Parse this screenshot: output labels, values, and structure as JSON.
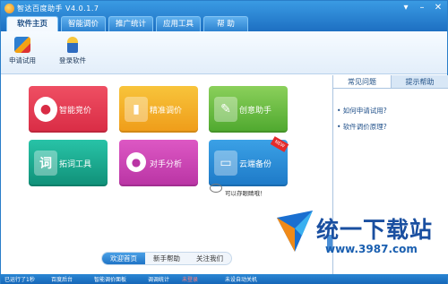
{
  "app": {
    "title": "智达百度助手 V4.0.1.7"
  },
  "window_buttons": [
    "▾",
    "–",
    "✕"
  ],
  "tabs": [
    {
      "label": "软件主页",
      "active": true
    },
    {
      "label": "智能调价",
      "active": false
    },
    {
      "label": "推广统计",
      "active": false
    },
    {
      "label": "应用工具",
      "active": false
    },
    {
      "label": "帮 助",
      "active": false
    }
  ],
  "toolbar": {
    "items": [
      {
        "label": "申请试用",
        "icon": "apply-icon"
      },
      {
        "label": "登录软件",
        "icon": "login-icon"
      }
    ]
  },
  "tiles": [
    {
      "label": "智能竞价",
      "icon_char": "",
      "color": "#e03a52"
    },
    {
      "label": "精准调价",
      "icon_char": "",
      "color": "#f3b12c"
    },
    {
      "label": "创意助手",
      "icon_char": "",
      "color": "#63bb40"
    },
    {
      "label": "拓词工具",
      "icon_char": "词",
      "color": "#19a98f"
    },
    {
      "label": "对手分析",
      "icon_char": "",
      "color": "#c844b2"
    },
    {
      "label": "云端备份",
      "icon_char": "",
      "color": "#2a8bd7"
    }
  ],
  "badge": {
    "label": "NEW"
  },
  "note": {
    "text": "可以存眼睛哦！"
  },
  "pager": {
    "items": [
      "欢迎首页",
      "新手帮助",
      "关注我们"
    ]
  },
  "side": {
    "tabs": [
      "常见问题",
      "提示帮助"
    ],
    "faq": [
      "• 如何申请试用?",
      "• 软件调价原理?"
    ]
  },
  "watermark": {
    "title": "统一下载站",
    "url": "www.3987.com"
  },
  "status": {
    "items": [
      {
        "text": "已运行了1秒",
        "color": "#ffffff"
      },
      {
        "text": "百度后台",
        "color": "#ffffff"
      },
      {
        "text": "智能调价面板",
        "color": "#ffffff"
      },
      {
        "text": "调调统计",
        "color": "#ffffff"
      },
      {
        "text": "未登录",
        "color": "#ff8080"
      },
      {
        "text": "未设自动关机",
        "color": "#ffffff"
      }
    ]
  }
}
